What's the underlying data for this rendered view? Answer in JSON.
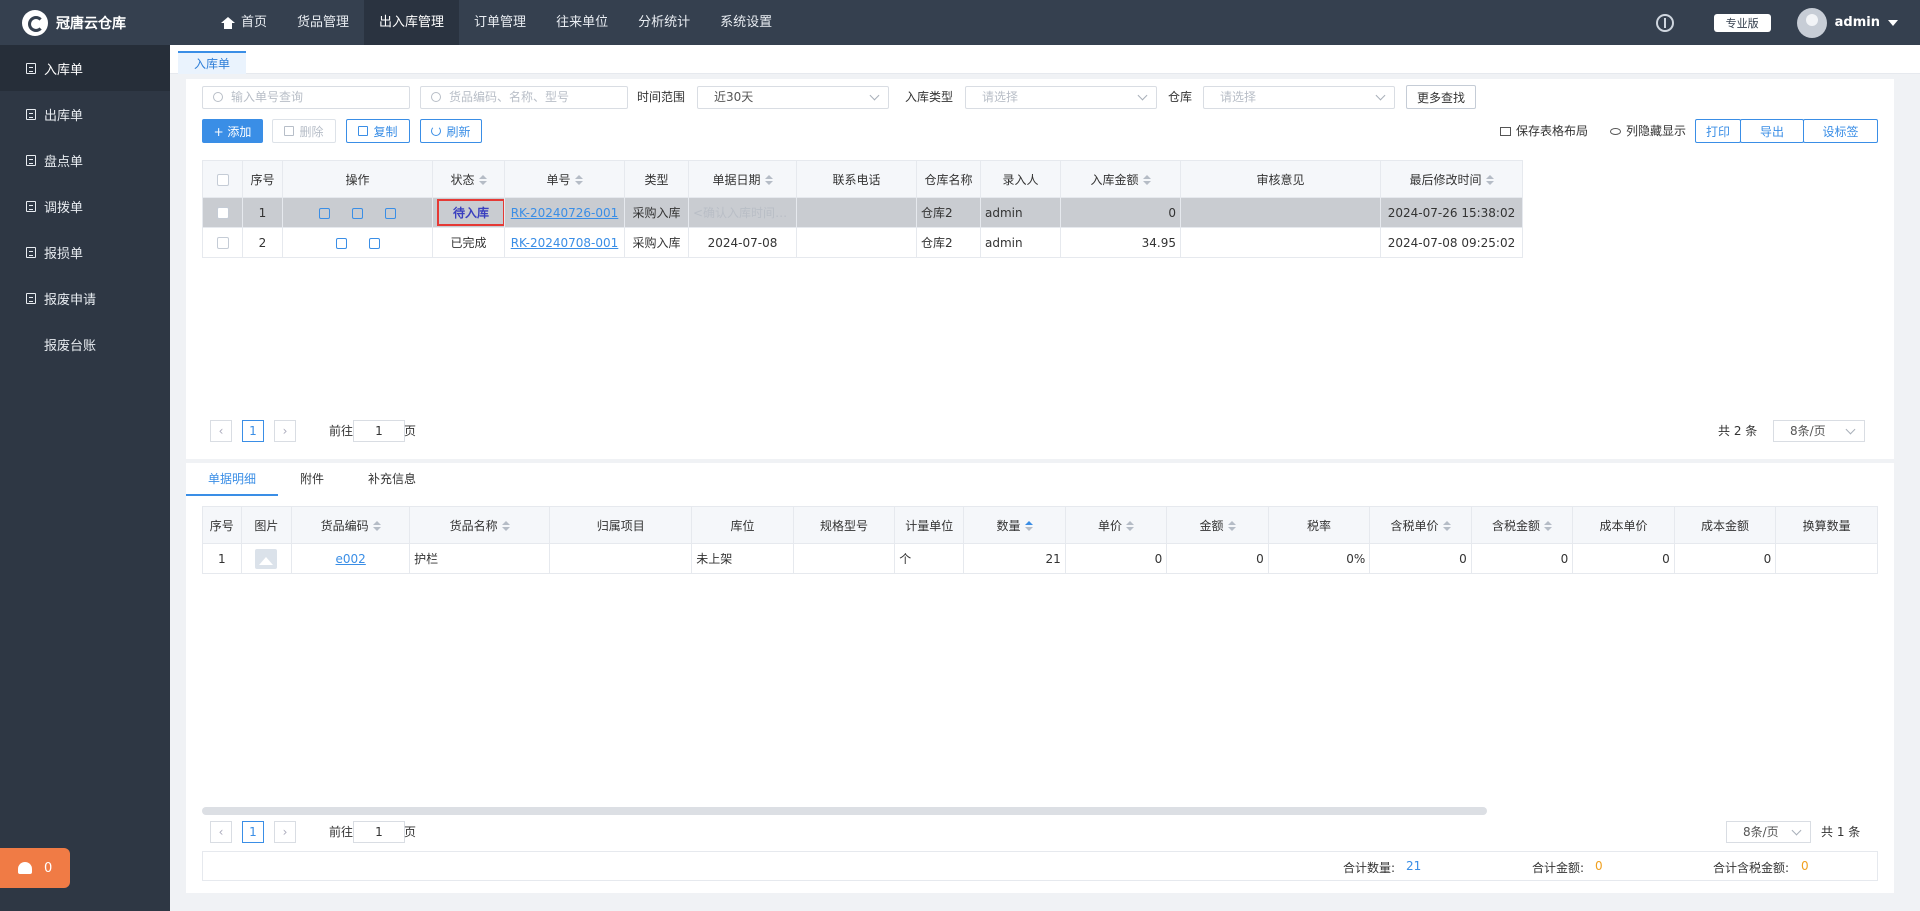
{
  "app": {
    "name": "冠唐云仓库",
    "edition": "专业版",
    "user": "admin"
  },
  "topnav": [
    {
      "label": "首页",
      "icon": "home-icon"
    },
    {
      "label": "货品管理"
    },
    {
      "label": "出入库管理",
      "active": true
    },
    {
      "label": "订单管理"
    },
    {
      "label": "往来单位"
    },
    {
      "label": "分析统计"
    },
    {
      "label": "系统设置"
    }
  ],
  "sidebar": [
    {
      "label": "入库单",
      "active": true
    },
    {
      "label": "出库单"
    },
    {
      "label": "盘点单"
    },
    {
      "label": "调拨单"
    },
    {
      "label": "报损单"
    },
    {
      "label": "报废申请"
    },
    {
      "label": "报废台账",
      "noicon": true
    }
  ],
  "alert": {
    "count": "0"
  },
  "tab": {
    "label": "入库单"
  },
  "filters": {
    "order_placeholder": "输入单号查询",
    "goods_placeholder": "货品编码、名称、型号",
    "time_label": "时间范围",
    "time_value": "近30天",
    "type_label": "入库类型",
    "type_placeholder": "请选择",
    "warehouse_label": "仓库",
    "warehouse_placeholder": "请选择",
    "more": "更多查找"
  },
  "toolbar": {
    "add": "+ 添加",
    "delete": "删除",
    "copy": "复制",
    "refresh": "刷新",
    "save_layout": "保存表格布局",
    "hide_cols": "列隐藏显示",
    "print": "打印",
    "export": "导出",
    "label": "设标签"
  },
  "table": {
    "headers": [
      "序号",
      "操作",
      "状态",
      "单号",
      "类型",
      "单据日期",
      "联系电话",
      "仓库名称",
      "录入人",
      "入库金额",
      "审核意见",
      "最后修改时间"
    ],
    "rows": [
      {
        "no": "1",
        "status": "待入库",
        "code": "RK-20240726-001",
        "type": "采购入库",
        "date": "<确认入库时间为准",
        "phone": "",
        "warehouse": "仓库2",
        "user": "admin",
        "amount": "0",
        "audit": "",
        "modified": "2024-07-26 15:38:02"
      },
      {
        "no": "2",
        "status": "已完成",
        "code": "RK-20240708-001",
        "type": "采购入库",
        "date": "2024-07-08",
        "phone": "",
        "warehouse": "仓库2",
        "user": "admin",
        "amount": "34.95",
        "audit": "",
        "modified": "2024-07-08 09:25:02"
      }
    ]
  },
  "pager": {
    "current": "1",
    "goto_prefix": "前往",
    "goto_value": "1",
    "goto_suffix": "页",
    "total": "共 2 条",
    "page_size": "8条/页"
  },
  "detail_tabs": [
    "单据明细",
    "附件",
    "补充信息"
  ],
  "detail": {
    "headers": [
      "序号",
      "图片",
      "货品编码",
      "货品名称",
      "归属项目",
      "库位",
      "规格型号",
      "计量单位",
      "数量",
      "单价",
      "金额",
      "税率",
      "含税单价",
      "含税金额",
      "成本单价",
      "成本金额",
      "换算数量"
    ],
    "rows": [
      {
        "no": "1",
        "code": "e002",
        "name": "护栏",
        "project": "",
        "location": "未上架",
        "spec": "",
        "unit": "个",
        "qty": "21",
        "price": "0",
        "amount": "0",
        "tax": "0%",
        "tax_price": "0",
        "tax_amount": "0",
        "cost_price": "0",
        "cost_amount": "0",
        "conv": ""
      }
    ]
  },
  "pager2": {
    "current": "1",
    "goto_prefix": "前往",
    "goto_value": "1",
    "goto_suffix": "页",
    "page_size": "8条/页",
    "total": "共 1 条"
  },
  "totals": {
    "qty_label": "合计数量:",
    "qty": "21",
    "amount_label": "合计金额:",
    "amount": "0",
    "tax_label": "合计含税金额:",
    "tax_amount": "0"
  },
  "colors": {
    "topbar": "#35404f",
    "sidebar": "#2e3744",
    "accent": "#3a8ee6",
    "alert": "#f07b45",
    "status_highlight": "#e53935",
    "total_value_blue": "#3a8ee6",
    "total_value_orange": "#f0a020"
  }
}
